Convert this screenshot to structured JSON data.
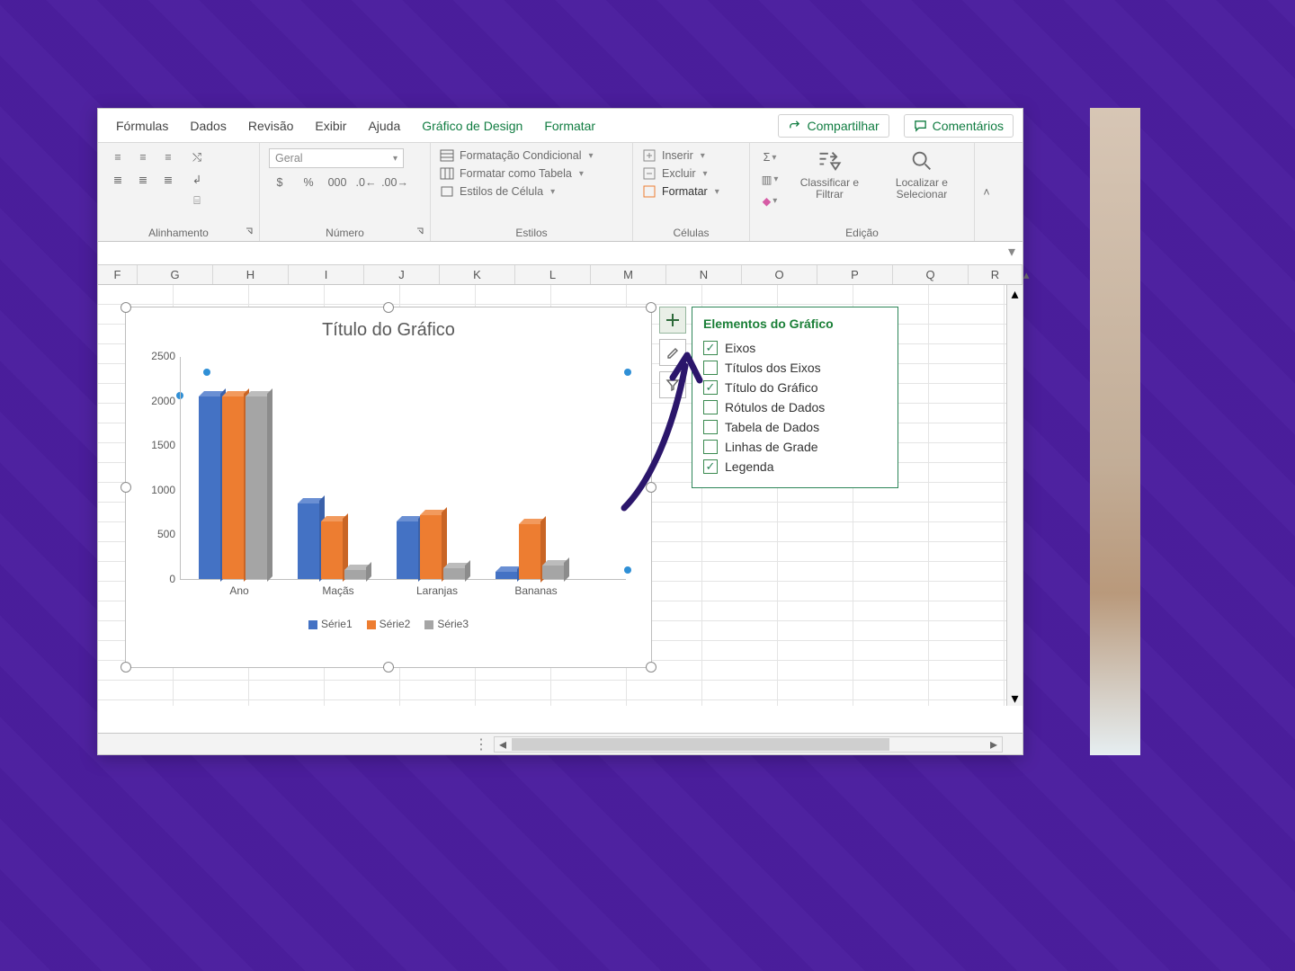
{
  "ribbon": {
    "tabs": [
      "Fórmulas",
      "Dados",
      "Revisão",
      "Exibir",
      "Ajuda"
    ],
    "context_tabs": [
      "Gráfico de Design",
      "Formatar"
    ],
    "share": "Compartilhar",
    "comments": "Comentários",
    "groups": {
      "alignment": "Alinhamento",
      "number": "Número",
      "number_format": "Geral",
      "styles": "Estilos",
      "styles_items": {
        "conditional": "Formatação Condicional",
        "table": "Formatar como Tabela",
        "cell": "Estilos de Célula"
      },
      "cells": "Células",
      "cells_items": {
        "insert": "Inserir",
        "delete": "Excluir",
        "format": "Formatar"
      },
      "editing": "Edição",
      "editing_items": {
        "sort": "Classificar e Filtrar",
        "find": "Localizar e Selecionar"
      }
    }
  },
  "columns": [
    "F",
    "G",
    "H",
    "I",
    "J",
    "K",
    "L",
    "M",
    "N",
    "O",
    "P",
    "Q",
    "R"
  ],
  "chart_elements": {
    "title": "Elementos do Gráfico",
    "items": [
      {
        "label": "Eixos",
        "checked": true
      },
      {
        "label": "Títulos dos Eixos",
        "checked": false
      },
      {
        "label": "Título do Gráfico",
        "checked": true
      },
      {
        "label": "Rótulos de Dados",
        "checked": false
      },
      {
        "label": "Tabela de Dados",
        "checked": false
      },
      {
        "label": "Linhas de Grade",
        "checked": false
      },
      {
        "label": "Legenda",
        "checked": true
      }
    ]
  },
  "chart_data": {
    "type": "bar",
    "title": "Título do Gráfico",
    "categories": [
      "Ano",
      "Maçãs",
      "Laranjas",
      "Bananas"
    ],
    "series": [
      {
        "name": "Série1",
        "values": [
          2050,
          850,
          650,
          80
        ],
        "color": "#4472c4"
      },
      {
        "name": "Série2",
        "values": [
          2050,
          650,
          720,
          620
        ],
        "color": "#ed7d31"
      },
      {
        "name": "Série3",
        "values": [
          2050,
          100,
          120,
          150
        ],
        "color": "#a5a5a5"
      }
    ],
    "ylim": [
      0,
      2500
    ],
    "yticks": [
      0,
      500,
      1000,
      1500,
      2000,
      2500
    ],
    "xlabel": "",
    "ylabel": ""
  }
}
